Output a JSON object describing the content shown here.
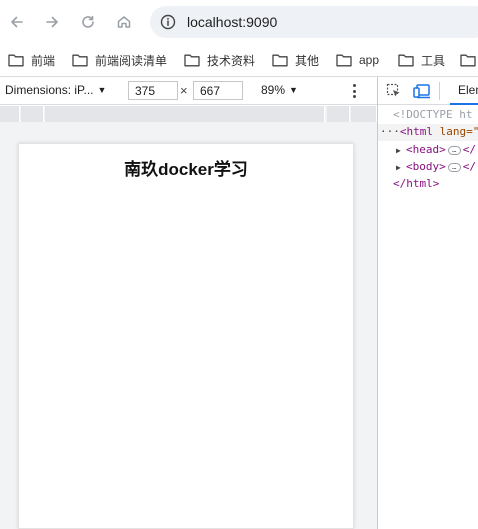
{
  "toolbar": {
    "url": "localhost:9090"
  },
  "bookmarks": [
    {
      "label": "前端",
      "icon": "folder-icon"
    },
    {
      "label": "前端阅读清单",
      "icon": "folder-icon"
    },
    {
      "label": "技术资料",
      "icon": "folder-icon"
    },
    {
      "label": "其他",
      "icon": "folder-icon"
    },
    {
      "label": "app",
      "icon": "folder-icon"
    },
    {
      "label": "工具",
      "icon": "folder-icon"
    }
  ],
  "device_toolbar": {
    "device": "Dimensions: iP...",
    "width": "375",
    "height": "667",
    "zoom": "89%",
    "times": "×"
  },
  "page": {
    "heading": "南玖docker学习"
  },
  "devtools": {
    "tab": "Elem",
    "doctype": "<!DOCTYPE ht",
    "html_open": "<html",
    "html_attr": "lang=\"",
    "head": "<head>",
    "body": "<body>",
    "close_frag": "</",
    "html_close": "</html>",
    "dots": "···",
    "ellipsis": "…"
  },
  "colors": {
    "accent": "#1a73e8",
    "tag": "#881280",
    "attr": "#994500"
  }
}
